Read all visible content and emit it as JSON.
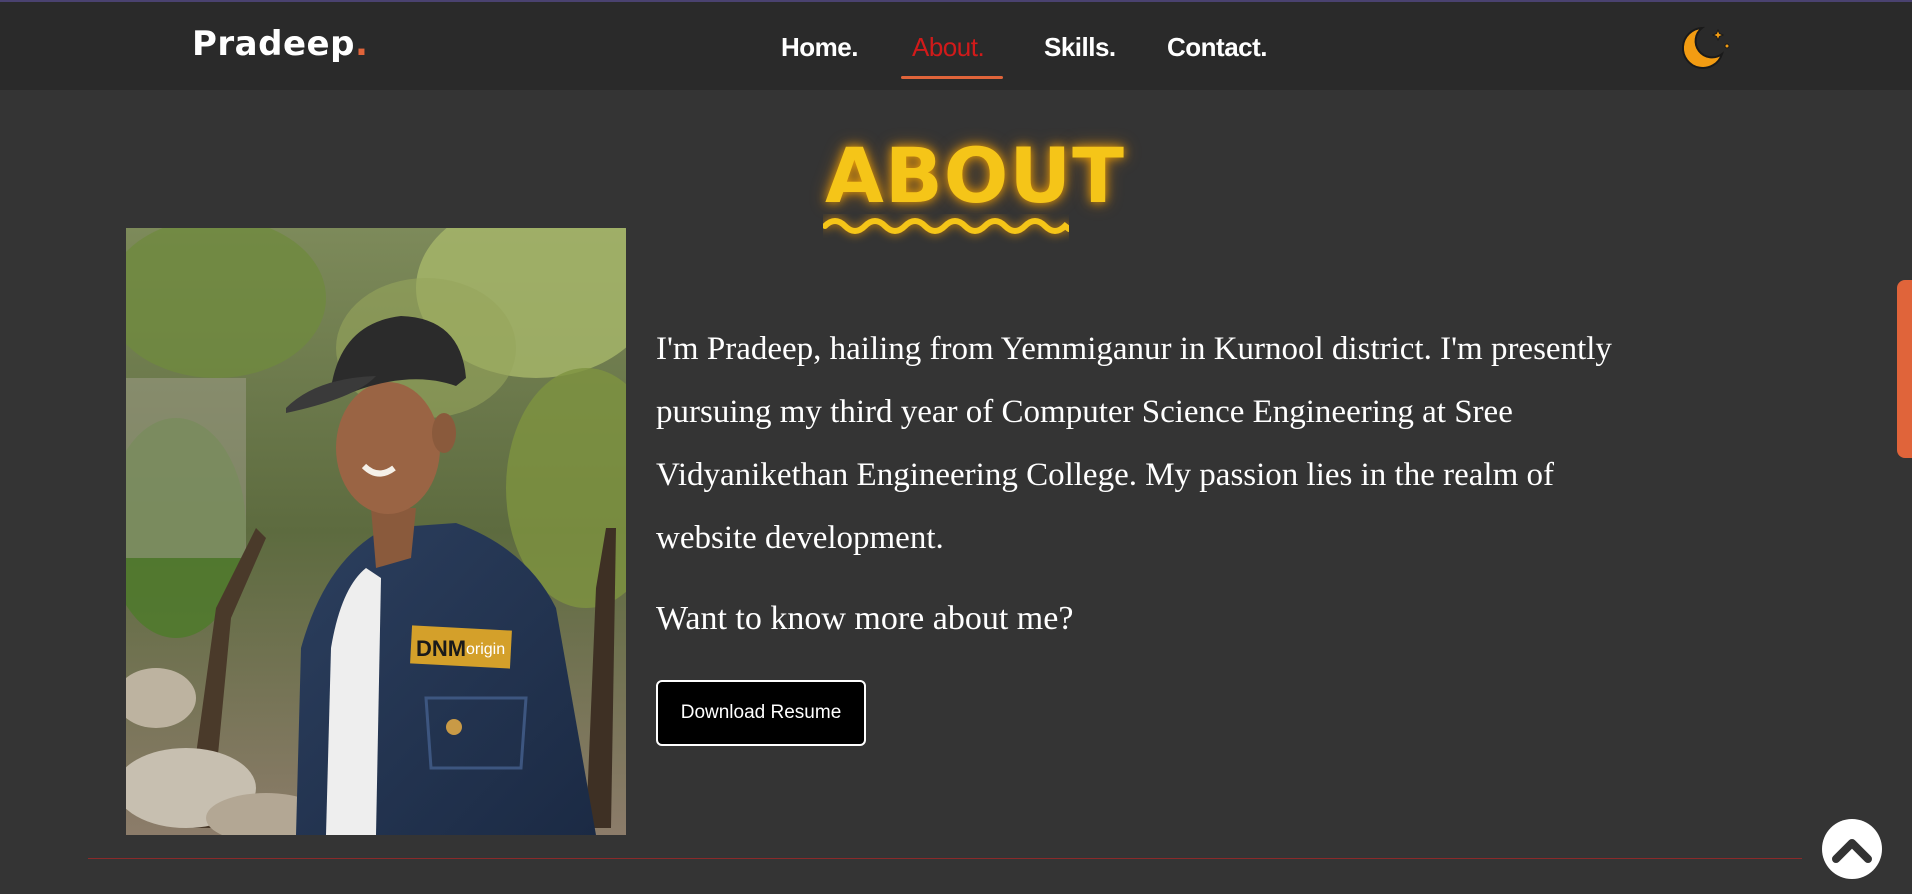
{
  "navbar": {
    "brand": "Pradeep",
    "brand_dot": ".",
    "items": [
      {
        "label": "Home."
      },
      {
        "label": "About."
      },
      {
        "label": "Skills."
      },
      {
        "label": "Contact."
      }
    ],
    "active_item": "About.",
    "theme_toggle_icon": "moon-icon"
  },
  "about": {
    "title": "ABOUT",
    "bio": "I'm Pradeep, hailing from Yemmiganur in Kurnool district. I'm presently pursuing my third year of Computer Science Engineering at Sree Vidyanikethan Engineering College. My passion lies in the realm of website development.",
    "more_prompt": "Want to know more about me?",
    "download_button": "Download Resume",
    "photo_shirt_text": "DNM",
    "photo_patch_text": "origin"
  },
  "scroll_top_icon": "chevron-up-icon",
  "colors": {
    "background": "#343434",
    "navbar": "#2a2a2a",
    "accent": "#e0643a",
    "active_link": "#d11a1a",
    "title": "#f5c518",
    "divider": "#8a2a2a"
  }
}
